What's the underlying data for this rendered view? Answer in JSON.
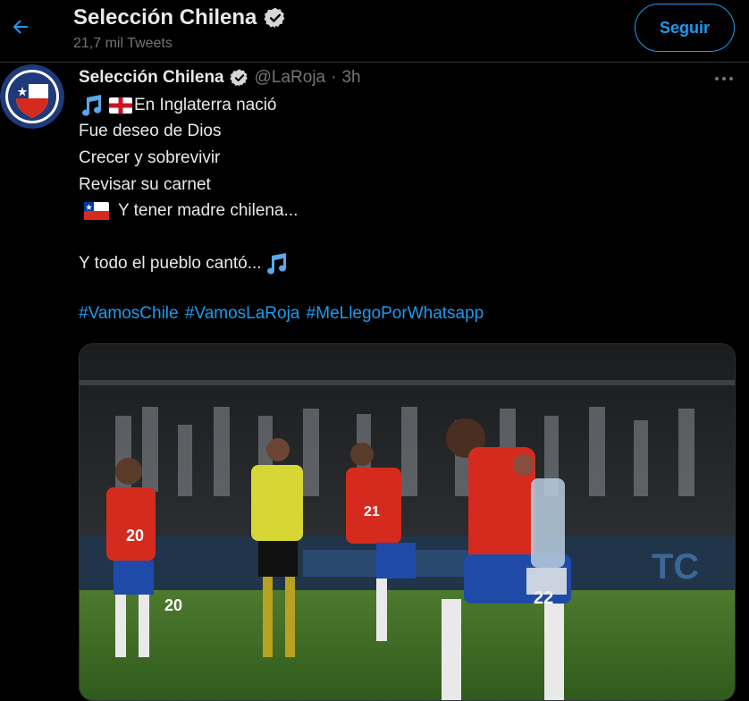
{
  "header": {
    "back_icon": "arrow-left-icon",
    "title": "Selección Chilena",
    "subtitle": "21,7 mil Tweets",
    "follow_label": "Seguir",
    "verified_icon": "verified-badge-icon"
  },
  "tweet": {
    "display_name": "Selección Chilena",
    "handle": "@LaRoja",
    "separator": "·",
    "time": "3h",
    "more_icon": "more-options-icon",
    "lines": {
      "l1": "En Inglaterra nació",
      "l2": "Fue deseo de Dios",
      "l3": "Crecer y sobrevivir",
      "l4": "Revisar su carnet",
      "l5": "Y tener madre chilena...",
      "l6": "Y todo el pueblo cantó..."
    },
    "hashtags": [
      "#VamosChile",
      "#VamosLaRoja",
      "#MeLlegoPorWhatsapp"
    ],
    "media": {
      "type": "photo",
      "jersey_numbers": [
        "20",
        "20",
        "21",
        "22"
      ]
    }
  },
  "colors": {
    "background": "#000000",
    "accent": "#1d9bf0",
    "text_primary": "#e7e9ea",
    "text_secondary": "#71767b"
  },
  "icons": [
    "arrow-left-icon",
    "verified-badge-icon",
    "more-options-icon",
    "music-note-icon",
    "england-flag-icon",
    "chile-flag-icon"
  ]
}
